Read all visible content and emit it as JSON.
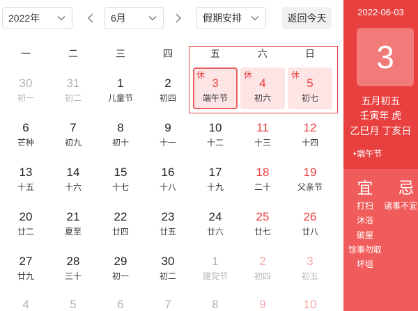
{
  "toolbar": {
    "year_select": {
      "value": "2022年",
      "icon": "chevron-down-icon"
    },
    "prev_month": {
      "icon": "chevron-left-icon"
    },
    "month_select": {
      "value": "6月",
      "icon": "chevron-down-icon"
    },
    "next_month": {
      "icon": "chevron-right-icon"
    },
    "holiday_select": {
      "value": "假期安排",
      "icon": "chevron-down-icon"
    },
    "today_button": {
      "label": "返回今天"
    }
  },
  "weekdays": [
    "一",
    "二",
    "三",
    "四",
    "五",
    "六",
    "日"
  ],
  "weeks": [
    [
      {
        "day": 30,
        "lunar": "初一",
        "other_month": true
      },
      {
        "day": 31,
        "lunar": "初二",
        "other_month": true
      },
      {
        "day": 1,
        "lunar": "儿童节"
      },
      {
        "day": 2,
        "lunar": "初四"
      },
      {
        "day": 3,
        "lunar": "端午节",
        "rest": "休",
        "selected": true
      },
      {
        "day": 4,
        "lunar": "初六",
        "rest": "休",
        "weekend": true
      },
      {
        "day": 5,
        "lunar": "初七",
        "rest": "休",
        "weekend": true
      }
    ],
    [
      {
        "day": 6,
        "lunar": "芒种"
      },
      {
        "day": 7,
        "lunar": "初九"
      },
      {
        "day": 8,
        "lunar": "初十"
      },
      {
        "day": 9,
        "lunar": "十一"
      },
      {
        "day": 10,
        "lunar": "十二"
      },
      {
        "day": 11,
        "lunar": "十三",
        "weekend": true
      },
      {
        "day": 12,
        "lunar": "十四",
        "weekend": true
      }
    ],
    [
      {
        "day": 13,
        "lunar": "十五"
      },
      {
        "day": 14,
        "lunar": "十六"
      },
      {
        "day": 15,
        "lunar": "十七"
      },
      {
        "day": 16,
        "lunar": "十八"
      },
      {
        "day": 17,
        "lunar": "十九"
      },
      {
        "day": 18,
        "lunar": "二十",
        "weekend": true
      },
      {
        "day": 19,
        "lunar": "父亲节",
        "weekend": true
      }
    ],
    [
      {
        "day": 20,
        "lunar": "廿二"
      },
      {
        "day": 21,
        "lunar": "夏至"
      },
      {
        "day": 22,
        "lunar": "廿四"
      },
      {
        "day": 23,
        "lunar": "廿五"
      },
      {
        "day": 24,
        "lunar": "廿六"
      },
      {
        "day": 25,
        "lunar": "廿七",
        "weekend": true
      },
      {
        "day": 26,
        "lunar": "廿八",
        "weekend": true
      }
    ],
    [
      {
        "day": 27,
        "lunar": "廿九"
      },
      {
        "day": 28,
        "lunar": "三十"
      },
      {
        "day": 29,
        "lunar": "初一"
      },
      {
        "day": 30,
        "lunar": "初二"
      },
      {
        "day": 1,
        "lunar": "建党节",
        "other_month": true
      },
      {
        "day": 2,
        "lunar": "初四",
        "other_month": true,
        "weekend": true
      },
      {
        "day": 3,
        "lunar": "初五",
        "other_month": true,
        "weekend": true
      }
    ],
    [
      {
        "day": 4,
        "other_month": true
      },
      {
        "day": 5,
        "other_month": true
      },
      {
        "day": 6,
        "other_month": true
      },
      {
        "day": 7,
        "other_month": true
      },
      {
        "day": 8,
        "other_month": true
      },
      {
        "day": 9,
        "other_month": true,
        "weekend": true
      },
      {
        "day": 10,
        "other_month": true,
        "weekend": true
      }
    ]
  ],
  "side_panel": {
    "date": "2022-06-03",
    "day": 3,
    "lunar_date": "五月初五",
    "year_ganzhi": "壬寅年 虎",
    "month_day_ganzhi": "乙巳月 丁亥日",
    "festivals": [
      "端午节"
    ],
    "yi_label": "宜",
    "ji_label": "忌",
    "yi": [
      "打扫",
      "沐浴",
      "破屋",
      "馀事勿取",
      "坏垣"
    ],
    "ji": [
      "诸事不宜"
    ]
  },
  "colors": {
    "accent": "#e8403f",
    "text": "#222222",
    "weekend_text": "#e8403f",
    "other_month_text": "#b4b4b4",
    "other_month_weekend_text": "#f3a9a9",
    "rest_bg": "#fde5e5",
    "selected_border": "#e9605f",
    "panel_top": "#e8403f",
    "panel_bottom": "#f05c5b",
    "date_box": "#f27a79"
  }
}
